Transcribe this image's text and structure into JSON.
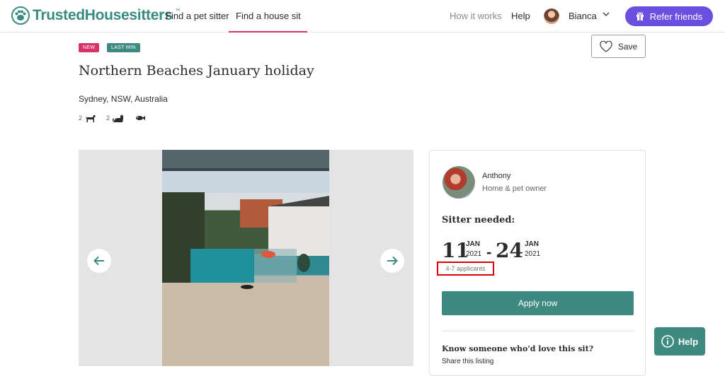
{
  "brand": {
    "name": "TrustedHousesitters",
    "tm": "™",
    "logo_icon": "paw-icon"
  },
  "nav": {
    "find_pet_sitter": "Find a pet sitter",
    "find_house_sit": "Find a house sit",
    "how_it_works": "How it works",
    "help": "Help",
    "user_name": "Bianca",
    "refer_friends": "Refer friends"
  },
  "listing": {
    "tags": [
      "NEW",
      "LAST MIN"
    ],
    "save_label": "Save",
    "title": "Northern Beaches January holiday",
    "location": "Sydney, NSW, Australia",
    "pets": [
      {
        "count": "2",
        "icon": "dog-icon"
      },
      {
        "count": "2",
        "icon": "cat-icon"
      },
      {
        "count": "",
        "icon": "fish-icon"
      }
    ]
  },
  "card": {
    "owner_name": "Anthony",
    "owner_role": "Home & pet owner",
    "sitter_needed": "Sitter needed:",
    "start": {
      "day": "11",
      "month": "JAN",
      "year": "2021"
    },
    "separator": "-",
    "end": {
      "day": "24",
      "month": "JAN",
      "year": "2021"
    },
    "applicants": "4-7 applicants",
    "apply_label": "Apply now",
    "share_title": "Know someone who'd love this sit?",
    "share_link": "Share this listing"
  },
  "help_widget": {
    "label": "Help"
  },
  "colors": {
    "accent": "#3f8a80",
    "brand_text": "#3a8a80",
    "refer": "#6a4fe0",
    "tag_new": "#d6336c",
    "highlight": "#e00000"
  }
}
